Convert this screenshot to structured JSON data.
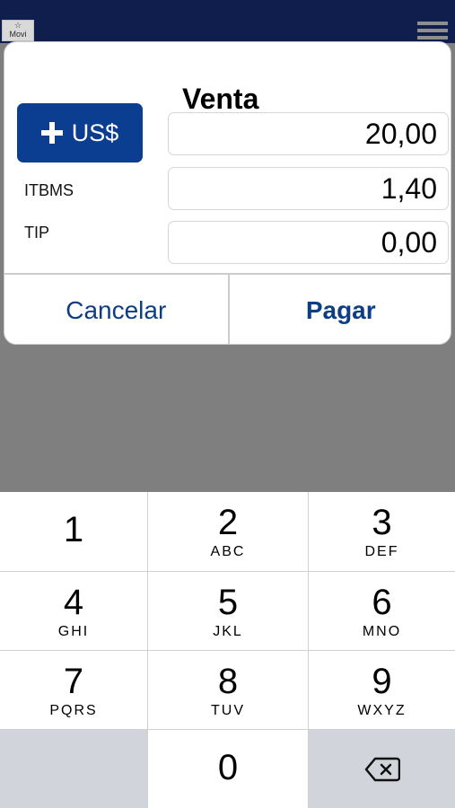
{
  "app": {
    "logo_text": "Movi"
  },
  "modal": {
    "title": "Venta",
    "currency_button_label": "US$",
    "fields": [
      {
        "label": "",
        "value": "20,00"
      },
      {
        "label": "ITBMS",
        "value": "1,40"
      },
      {
        "label": "TIP",
        "value": "0,00"
      }
    ],
    "cancel_label": "Cancelar",
    "pay_label": "Pagar"
  },
  "keypad": {
    "keys": [
      {
        "digit": "1",
        "letters": ""
      },
      {
        "digit": "2",
        "letters": "ABC"
      },
      {
        "digit": "3",
        "letters": "DEF"
      },
      {
        "digit": "4",
        "letters": "GHI"
      },
      {
        "digit": "5",
        "letters": "JKL"
      },
      {
        "digit": "6",
        "letters": "MNO"
      },
      {
        "digit": "7",
        "letters": "PQRS"
      },
      {
        "digit": "8",
        "letters": "TUV"
      },
      {
        "digit": "9",
        "letters": "WXYZ"
      },
      {
        "digit": "0",
        "letters": ""
      }
    ],
    "delete_icon": "backspace-icon"
  },
  "colors": {
    "primary_blue": "#0b3d91",
    "action_blue": "#0f3d83",
    "top_bar": "#0f1e4d",
    "overlay_gray": "#7f7f7f"
  }
}
